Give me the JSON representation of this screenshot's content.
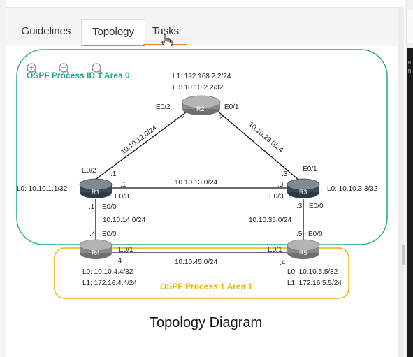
{
  "tabs": [
    {
      "label": "Guidelines",
      "active": false
    },
    {
      "label": "Topology",
      "active": true
    },
    {
      "label": "Tasks",
      "active": false
    }
  ],
  "diagram": {
    "caption": "Topology Diagram",
    "area_green_label": "OSPF Process ID 1 Area 0",
    "area_yellow_label": "OSPF Process 1 Area 1",
    "colors": {
      "area0": "#22a88a",
      "area1": "#f0b400",
      "accent": "#e8833a"
    },
    "routers": [
      {
        "name": "R1",
        "lines": [
          "L0: 10.10.1.1/32"
        ]
      },
      {
        "name": "R2",
        "lines": [
          "L1: 192.168.2.2/24",
          "L0: 10.10.2.2/32"
        ]
      },
      {
        "name": "R3",
        "lines": [
          "L0: 10.10.3.3/32"
        ]
      },
      {
        "name": "R4",
        "lines": [
          "L0: 10.10.4.4/32",
          "L1: 172.16.4.4/24"
        ]
      },
      {
        "name": "R5",
        "lines": [
          "L0: 10.10.5.5/32",
          "L1: 172.16.5.5/24"
        ]
      }
    ],
    "links": [
      {
        "network": "10.10.12.0/24"
      },
      {
        "network": "10.10.23.0/24"
      },
      {
        "network": "10.10.13.0/24"
      },
      {
        "network": "10.10.14.0/24"
      },
      {
        "network": "10.10.35.0/24"
      },
      {
        "network": "10.10.45.0/24"
      }
    ],
    "interfaces": {
      "r2_e02": "E0/2",
      "r2_e01": "E0/1",
      "r2_h1": ".2",
      "r2_h2": ".2",
      "r1_e02": "E0/2",
      "r1_h_top": ".1",
      "r1_e03": "E0/3",
      "r1_h_right": ".1",
      "r1_h_down": ".1",
      "r1_e00": "E0/0",
      "r3_e01": "E0/1",
      "r3_h_top": ".3",
      "r3_h_left": ".3",
      "r3_e03": "E0/3",
      "r3_h_down": ".3",
      "r3_e00": "E0/0",
      "r4_h_top": ".4",
      "r4_e00": "E0/0",
      "r4_e01": "E0/1",
      "r4_h_right": ".4",
      "r5_h_top": ".5",
      "r5_e00": "E0/0",
      "r5_e01": "E0/1",
      "r5_h_left": ".4"
    },
    "zoom_controls": [
      "zoom-in",
      "zoom-out",
      "search"
    ]
  },
  "side_panel": {
    "text_lines": [
      "R",
      "R"
    ]
  }
}
